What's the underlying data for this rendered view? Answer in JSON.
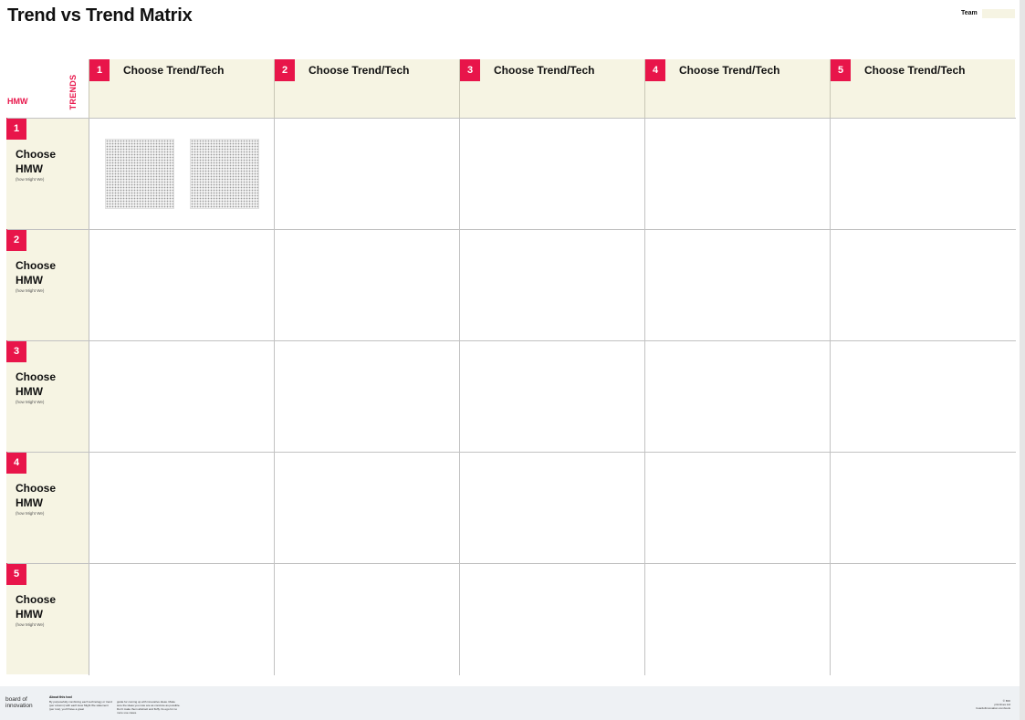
{
  "title": "Trend vs Trend Matrix",
  "team_label": "Team",
  "axis": {
    "hmw": "HMW",
    "trends": "TRENDS"
  },
  "columns": [
    {
      "num": "1",
      "label": "Choose Trend/Tech"
    },
    {
      "num": "2",
      "label": "Choose Trend/Tech"
    },
    {
      "num": "3",
      "label": "Choose Trend/Tech"
    },
    {
      "num": "4",
      "label": "Choose Trend/Tech"
    },
    {
      "num": "5",
      "label": "Choose Trend/Tech"
    }
  ],
  "rows": [
    {
      "num": "1",
      "label": "Choose HMW",
      "sub": "(how Might We)"
    },
    {
      "num": "2",
      "label": "Choose HMW",
      "sub": "(how Might We)"
    },
    {
      "num": "3",
      "label": "Choose HMW",
      "sub": "(how Might We)"
    },
    {
      "num": "4",
      "label": "Choose HMW",
      "sub": "(how Might We)"
    },
    {
      "num": "5",
      "label": "Choose HMW",
      "sub": "(how Might We)"
    }
  ],
  "footer": {
    "logo_line1": "board of",
    "logo_line2": "innovation",
    "about_title": "About this tool",
    "about_text_1": "By purposefully combining each technology or trend (per column) with each How Might We statement (per row), you'll have a great",
    "about_text_2": "guide for coming up with innovative ideas. Make sure the ideas you note are as concrete as possible. Don't make them abstract and fluffy. Its ego for no more use cases.",
    "right_line1": "© BOI",
    "right_line2": "primitives Ltd",
    "right_line3": "boardofinnovation.com/tools"
  },
  "colors": {
    "accent": "#e8154a",
    "header_bg": "#f6f4e3",
    "footer_bg": "#eef1f4"
  }
}
